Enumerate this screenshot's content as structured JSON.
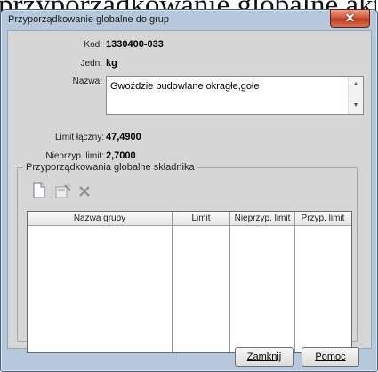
{
  "background_title": "przyporządkowanie globalne akt",
  "window": {
    "title": "Przyporządkowanie globalne do grup",
    "close_glyph": "✕"
  },
  "fields": {
    "kod_label": "Kod:",
    "kod_value": "1330400-033",
    "jedn_label": "Jedn:",
    "jedn_value": "kg",
    "nazwa_label": "Nazwa:",
    "nazwa_value": "Gwoździe budowlane okragłe,gołe",
    "limit_label": "Limit łączny:",
    "limit_value": "47,4900",
    "nieprzyp_label": "Nieprzyp. limit:",
    "nieprzyp_value": "2,7000"
  },
  "group": {
    "legend": "Przyporządkowania  globalne składnika",
    "toolbar": [
      {
        "name": "new-icon"
      },
      {
        "name": "edit-icon"
      },
      {
        "name": "delete-icon"
      }
    ],
    "columns": [
      "Nazwa grupy",
      "Limit",
      "Nieprzyp. limit",
      "Przyp. limit"
    ]
  },
  "footer": {
    "close_label": "Zamknij",
    "help_label": "Pomoc"
  },
  "colors": {
    "frame": "#b6c8dc",
    "client": "#d6d6d6",
    "close": "#c94a2c"
  }
}
